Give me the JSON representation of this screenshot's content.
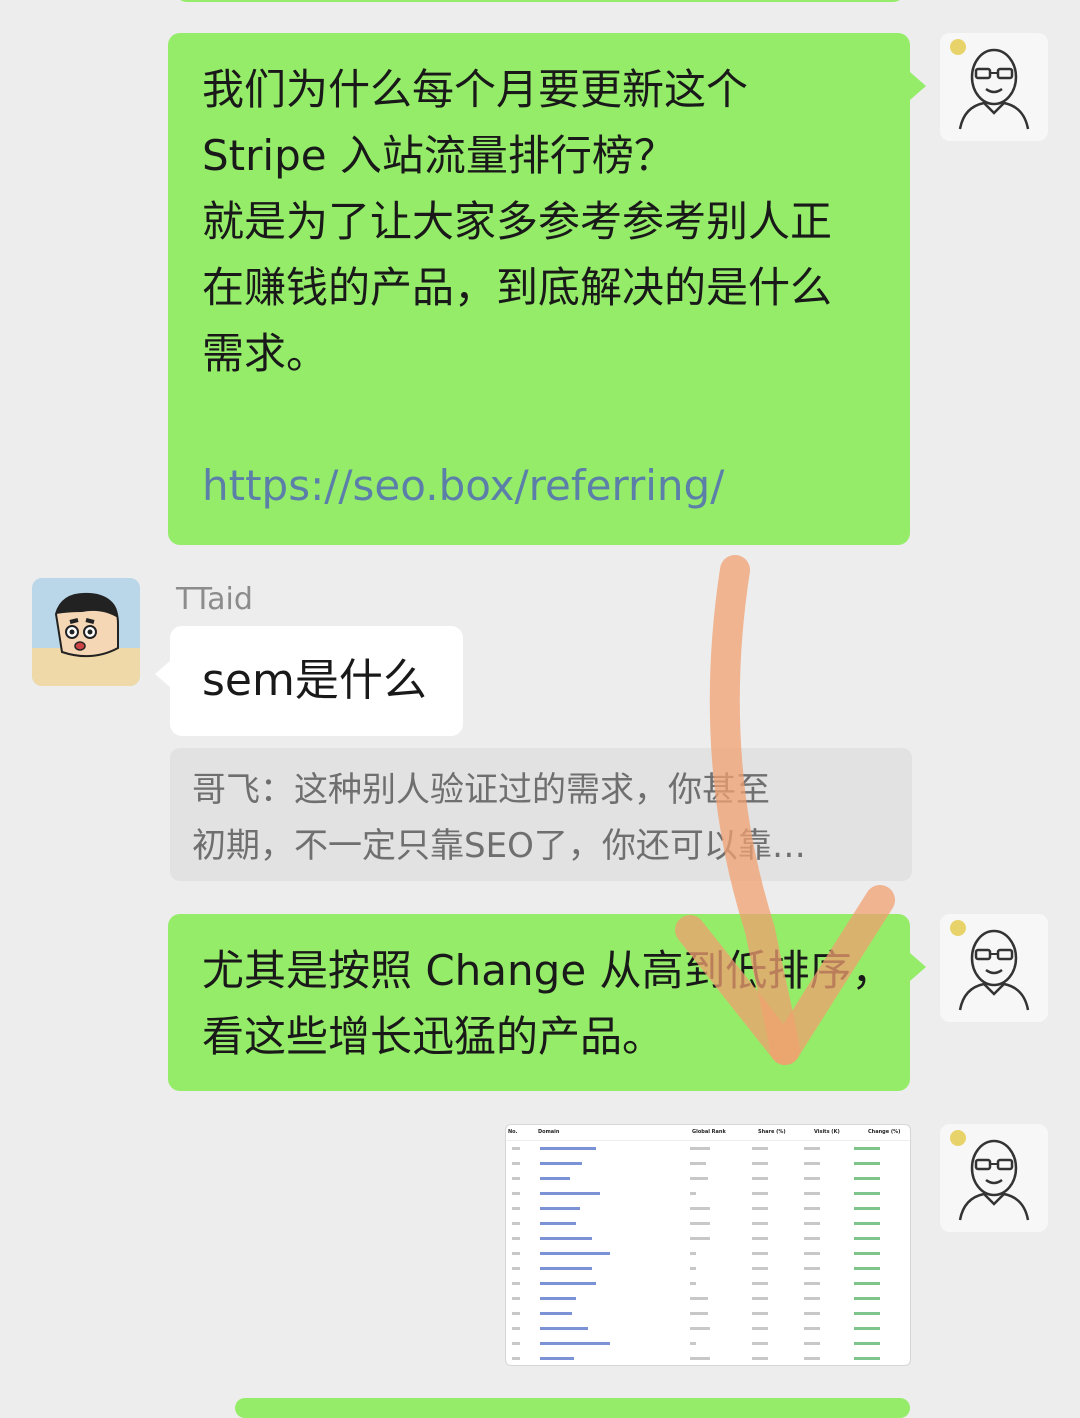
{
  "messages": {
    "m1": {
      "lines": [
        "我们为什么每个月要更新这个",
        "Stripe 入站流量排行榜？",
        "就是为了让大家多参考参考别人正",
        "在赚钱的产品，到底解决的是什么",
        "需求。"
      ],
      "link": "https://seo.box/referring/"
    },
    "m2": {
      "sender": "TTaid",
      "text": "sem是什么",
      "quote_lines": [
        "哥飞：这种别人验证过的需求，你甚至",
        "初期，不一定只靠SEO了，你还可以靠…"
      ]
    },
    "m3": {
      "lines": [
        "尤其是按照 Change 从高到低排序，",
        "看这些增长迅猛的产品。"
      ]
    },
    "m4": {
      "table_headers": [
        "No.",
        "Domain",
        "Global Rank",
        "Share (%)",
        "Visits (K)",
        "Change (%)"
      ]
    }
  },
  "colors": {
    "background": "#ededed",
    "bubble_self": "#95ec69",
    "bubble_other": "#ffffff",
    "link": "#5b7fa8",
    "annotation_arrow": "#f0a070"
  }
}
